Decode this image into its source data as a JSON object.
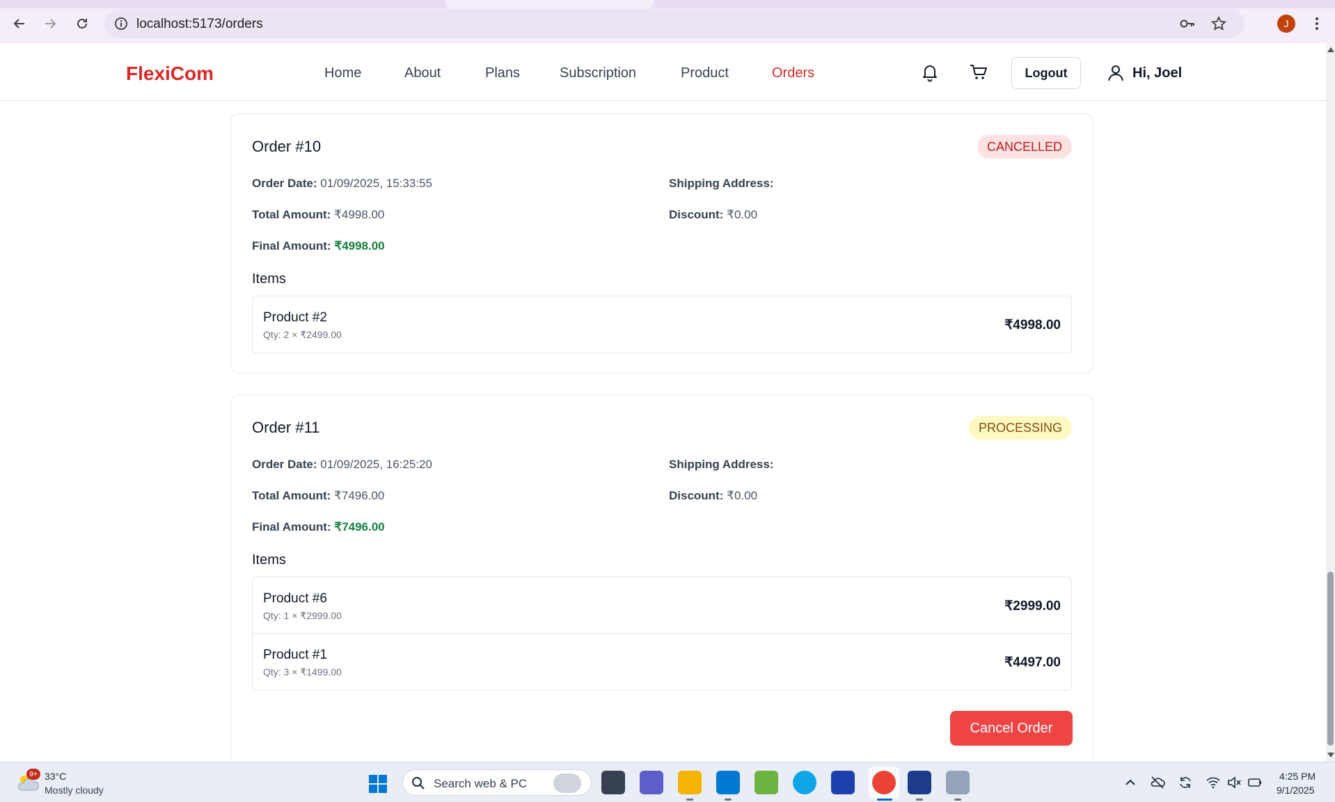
{
  "browser": {
    "url": "localhost:5173/orders",
    "profile_initial": "J"
  },
  "header": {
    "brand": "FlexiCom",
    "nav": [
      "Home",
      "About",
      "Plans",
      "Subscription",
      "Product",
      "Orders"
    ],
    "active_nav": "Orders",
    "logout_label": "Logout",
    "greeting": "Hi, Joel"
  },
  "orders": [
    {
      "title": "Order #10",
      "status": "CANCELLED",
      "order_date_label": "Order Date:",
      "order_date": "01/09/2025, 15:33:55",
      "shipping_label": "Shipping Address:",
      "shipping_value": "",
      "total_label": "Total Amount:",
      "total": "₹4998.00",
      "discount_label": "Discount:",
      "discount": "₹0.00",
      "final_label": "Final Amount:",
      "final": "₹4998.00",
      "items_title": "Items",
      "items": [
        {
          "name": "Product #2",
          "qty": "Qty: 2 × ₹2499.00",
          "price": "₹4998.00"
        }
      ]
    },
    {
      "title": "Order #11",
      "status": "PROCESSING",
      "order_date_label": "Order Date:",
      "order_date": "01/09/2025, 16:25:20",
      "shipping_label": "Shipping Address:",
      "shipping_value": "",
      "total_label": "Total Amount:",
      "total": "₹7496.00",
      "discount_label": "Discount:",
      "discount": "₹0.00",
      "final_label": "Final Amount:",
      "final": "₹7496.00",
      "items_title": "Items",
      "items": [
        {
          "name": "Product #6",
          "qty": "Qty: 1 × ₹2999.00",
          "price": "₹2999.00"
        },
        {
          "name": "Product #1",
          "qty": "Qty: 3 × ₹1499.00",
          "price": "₹4497.00"
        }
      ],
      "cancel_label": "Cancel Order"
    }
  ],
  "taskbar": {
    "temperature": "33°C",
    "condition": "Mostly cloudy",
    "weather_badge": "9+",
    "search_placeholder": "Search web & PC",
    "time": "4:25 PM",
    "date": "9/1/2025"
  },
  "colors": {
    "brand": "#dc2626",
    "cancel_button": "#ef4444",
    "final_amount": "#15803d"
  }
}
